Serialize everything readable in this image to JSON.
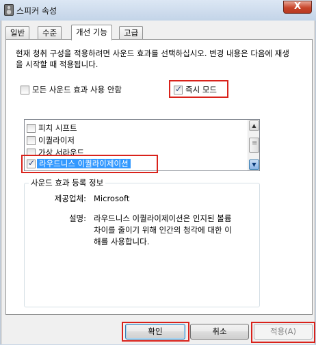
{
  "window": {
    "title": "스피커 속성",
    "close_label": "X"
  },
  "tabs": [
    {
      "label": "일반"
    },
    {
      "label": "수준"
    },
    {
      "label": "개선 기능"
    },
    {
      "label": "고급"
    }
  ],
  "description": "현재 청취 구성을 적용하려면 사운드 효과를 선택하십시오. 변경 내용은 다음에 재생을 시작할 때 적용됩니다.",
  "disable_all": {
    "label": "모든 사운드 효과 사용 안함",
    "checked": false
  },
  "immediate_mode": {
    "label": "즉시 모드",
    "checked": true
  },
  "effects": [
    {
      "label": "피치 시프트",
      "checked": false
    },
    {
      "label": "이퀄라이저",
      "checked": false
    },
    {
      "label": "가상 서라운드",
      "checked": false
    },
    {
      "label": "라우드니스 이퀄라이제이션",
      "checked": true,
      "selected": true
    }
  ],
  "info": {
    "title": "사운드 효과 등록 정보",
    "provider_label": "제공업체:",
    "provider_value": "Microsoft",
    "desc_label": "설명:",
    "desc_line1": "라우드니스 이퀄라이제이션은 인지된 볼륨",
    "desc_line2": "차이를 줄이기 위해 인간의 청각에 대한 이",
    "desc_line3": "해를 사용합니다."
  },
  "buttons": {
    "ok": "확인",
    "cancel": "취소",
    "apply": "적용(A)"
  },
  "colors": {
    "highlight": "#d9221b",
    "selection": "#3399ff"
  }
}
